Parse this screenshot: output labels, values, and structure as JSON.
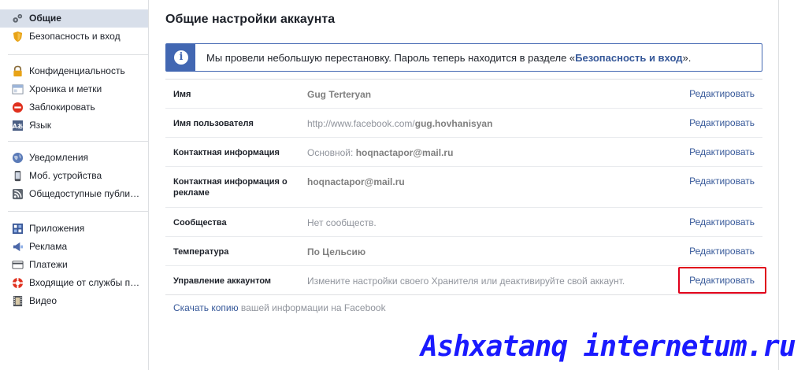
{
  "sidebar": {
    "group1": [
      {
        "label": "Общие",
        "icon": "gears-icon",
        "selected": true
      },
      {
        "label": "Безопасность и вход",
        "icon": "shield-icon"
      }
    ],
    "group2": [
      {
        "label": "Конфиденциальность",
        "icon": "lock-icon"
      },
      {
        "label": "Хроника и метки",
        "icon": "timeline-icon"
      },
      {
        "label": "Заблокировать",
        "icon": "block-icon"
      },
      {
        "label": "Язык",
        "icon": "language-icon"
      }
    ],
    "group3": [
      {
        "label": "Уведомления",
        "icon": "globe-icon"
      },
      {
        "label": "Моб. устройства",
        "icon": "mobile-icon"
      },
      {
        "label": "Общедоступные публи…",
        "icon": "rss-icon"
      }
    ],
    "group4": [
      {
        "label": "Приложения",
        "icon": "apps-icon"
      },
      {
        "label": "Реклама",
        "icon": "ads-icon"
      },
      {
        "label": "Платежи",
        "icon": "card-icon"
      },
      {
        "label": "Входящие от службы п…",
        "icon": "lifebuoy-icon"
      },
      {
        "label": "Видео",
        "icon": "film-icon"
      }
    ]
  },
  "main": {
    "title": "Общие настройки аккаунта",
    "notice": {
      "text_before": "Мы провели небольшую перестановку. Пароль теперь находится в разделе «",
      "link": "Безопасность и вход",
      "text_after": "»."
    },
    "rows": [
      {
        "label": "Имя",
        "value_plain": "",
        "value_bold": "Gug Terteryan",
        "edit": "Редактировать"
      },
      {
        "label": "Имя пользователя",
        "value_plain": "http://www.facebook.com/",
        "value_bold": "gug.hovhanisyan",
        "edit": "Редактировать"
      },
      {
        "label": "Контактная информация",
        "value_plain": "Основной: ",
        "value_bold": "hoqnactapor@mail.ru",
        "edit": "Редактировать"
      },
      {
        "label": "Контактная информация о рекламе",
        "value_plain": "",
        "value_bold": "hoqnactapor@mail.ru",
        "edit": "Редактировать"
      },
      {
        "label": "Сообщества",
        "value_plain": "Нет сообществ.",
        "value_bold": "",
        "edit": "Редактировать"
      },
      {
        "label": "Температура",
        "value_plain": "",
        "value_bold": "По Цельсию",
        "edit": "Редактировать"
      },
      {
        "label": "Управление аккаунтом",
        "value_plain": "Измените настройки своего Хранителя или деактивируйте свой аккаунт.",
        "value_bold": "",
        "edit": "Редактировать"
      }
    ],
    "download": {
      "link": "Скачать копию",
      "text": " вашей информации на Facebook"
    }
  },
  "watermark": "Ashxatanq internetum.ru",
  "colors": {
    "accent": "#4267b2",
    "link": "#365899",
    "highlight": "#e0001b",
    "selected_bg": "#d8dfea",
    "watermark": "#1a1aff"
  }
}
